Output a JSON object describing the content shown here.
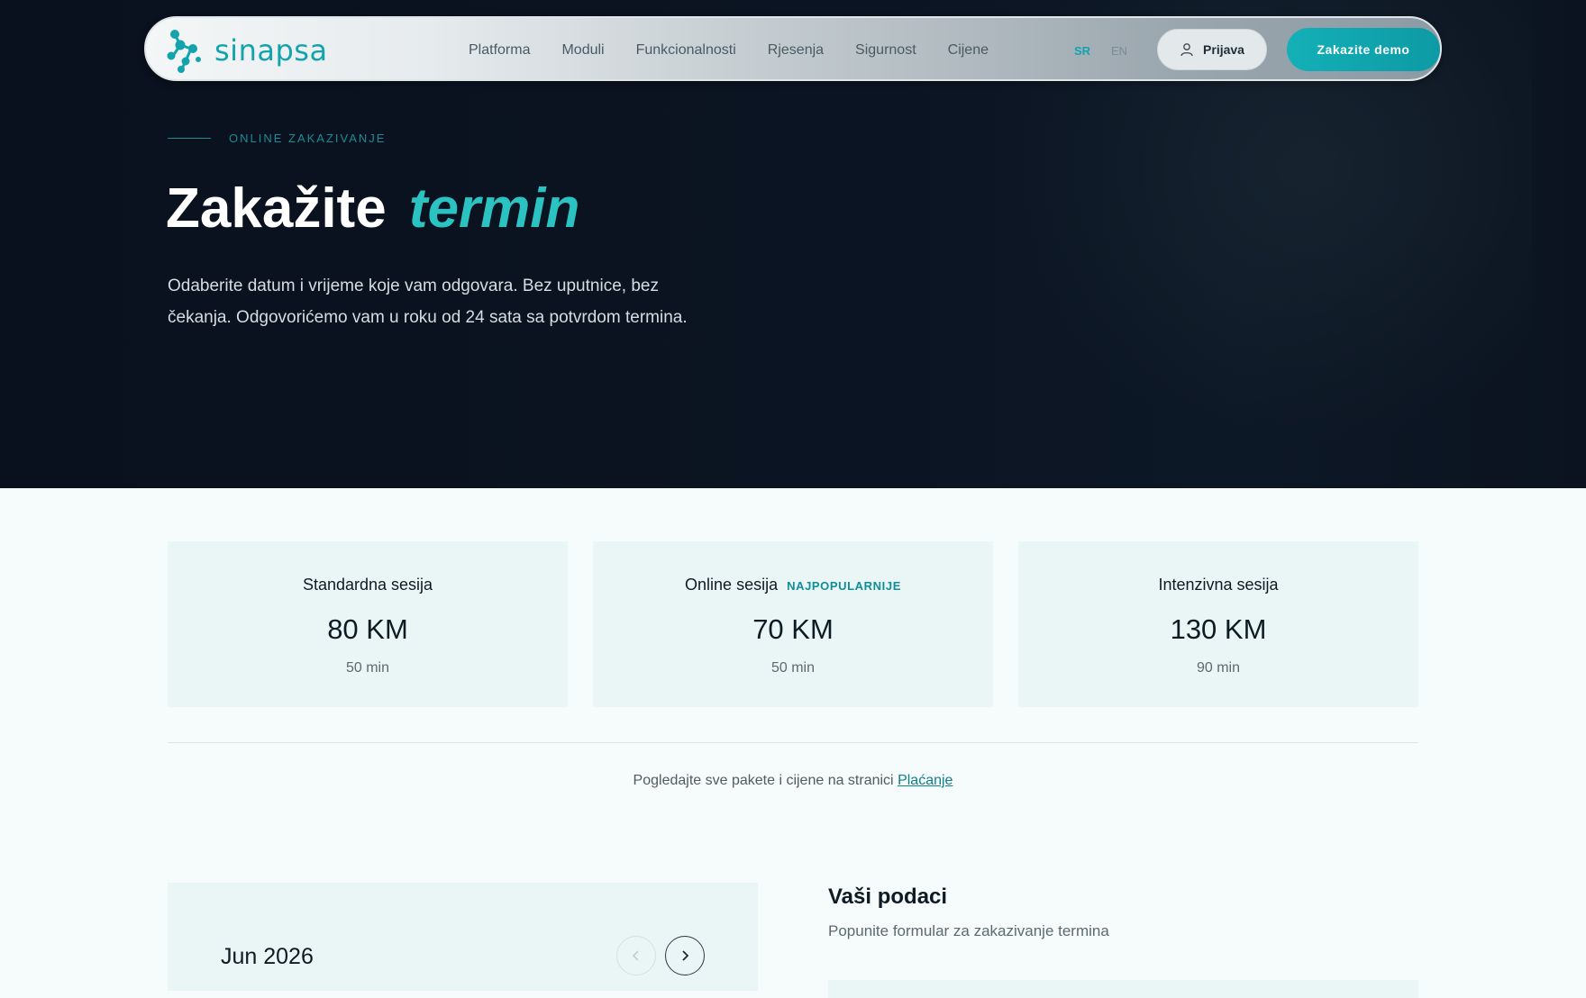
{
  "brand": {
    "name": "sinapsa",
    "logo_icon": "molecule-logo-icon",
    "color": "#12a3ad"
  },
  "nav": {
    "links": [
      "Platforma",
      "Moduli",
      "Funkcionalnosti",
      "Rjesenja",
      "Sigurnost",
      "Cijene"
    ],
    "lang_active": "SR",
    "lang_other": "EN",
    "login_label": "Prijava",
    "login_icon": "user-icon",
    "demo_label": "Zakazite demo"
  },
  "hero": {
    "eyebrow": "ONLINE ZAKAZIVANJE",
    "title": "Zakažite",
    "title_accent": "termin",
    "description": "Odaberite datum i vrijeme koje vam odgovara. Bez uputnice, bez čekanja. Odgovorićemo vam u roku od 24 sata sa potvrdom termina."
  },
  "sessions": [
    {
      "name": "Standardna sesija",
      "badge": "",
      "price": "80 KM",
      "duration": "50 min"
    },
    {
      "name": "Online sesija",
      "badge": "NAJPOPULARNIJE",
      "price": "70 KM",
      "duration": "50 min"
    },
    {
      "name": "Intenzivna sesija",
      "badge": "",
      "price": "130 KM",
      "duration": "90 min"
    }
  ],
  "packages_note": {
    "text": "Pogledajte sve pakete i cijene na stranici",
    "link": "Plaćanje"
  },
  "calendar": {
    "month": "Jun 2026",
    "prev_icon": "chevron-left-icon",
    "next_icon": "chevron-right-icon"
  },
  "form": {
    "title": "Vaši podaci",
    "subtitle": "Popunite formular za zakazivanje termina"
  },
  "colors": {
    "accent": "#12a3ad",
    "hero_bg": "#0a111e",
    "card_bg": "#eaf6f6"
  }
}
